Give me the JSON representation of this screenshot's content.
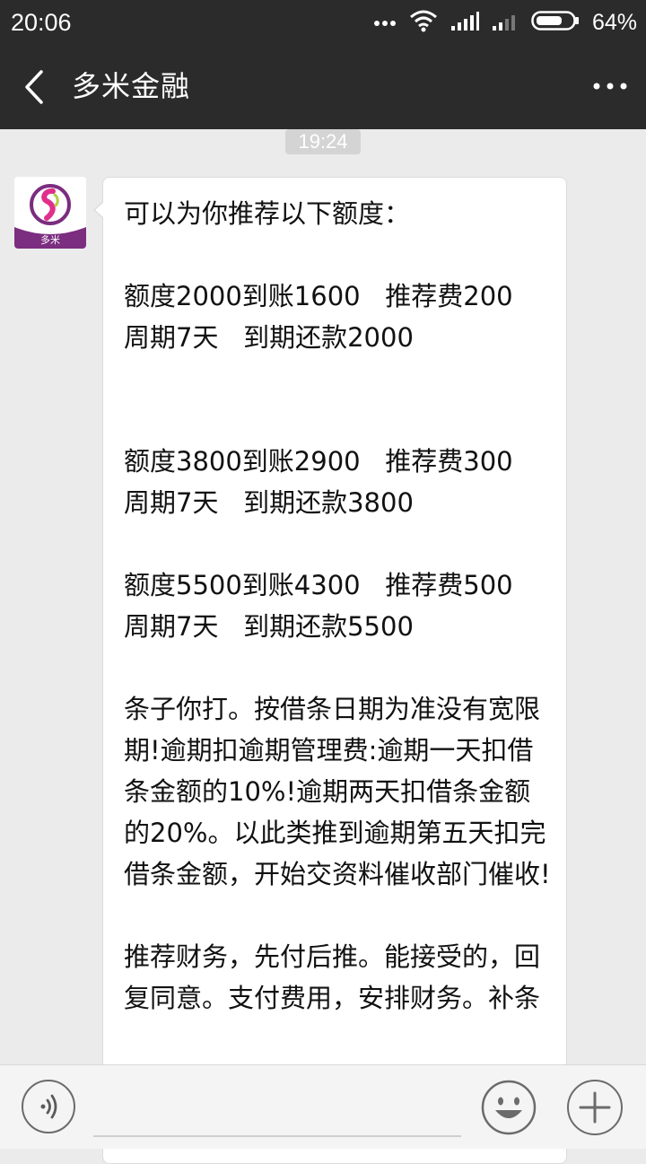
{
  "status_bar": {
    "time": "20:06",
    "battery_percent": "64%",
    "icons": [
      "more-dots-icon",
      "wifi-icon",
      "signal-icon",
      "signal-icon-2",
      "battery-icon"
    ]
  },
  "header": {
    "title": "多米金融",
    "back_icon": "chevron-left-icon",
    "menu_icon": "more-horizontal-icon"
  },
  "chat": {
    "timestamp": "19:24",
    "messages": [
      {
        "sender_avatar": "duomi-logo",
        "avatar_text": "多米",
        "text": "可以为你推荐以下额度：\n\n额度2000到账1600   推荐费200    周期7天   到期还款2000\n\n\n额度3800到账2900   推荐费300    周期7天   到期还款3800\n\n额度5500到账4300   推荐费500    周期7天   到期还款5500\n\n条子你打。按借条日期为准没有宽限期!逾期扣逾期管理费:逾期一天扣借条金额的10%!逾期两天扣借条金额的20%。以此类推到逾期第五天扣完借条金额，开始交资料催收部门催收!\n\n推荐财务，先付后推。能接受的，回复同意。支付费用，安排财务。补条"
      }
    ]
  },
  "input_bar": {
    "voice_icon": "voice-icon",
    "placeholder": "",
    "emoji_icon": "emoji-icon",
    "plus_icon": "plus-icon"
  },
  "colors": {
    "header_bg": "#2b2b2b",
    "chat_bg": "#ebebeb",
    "bubble_bg": "#ffffff",
    "logo_purple": "#7b2d7f"
  }
}
